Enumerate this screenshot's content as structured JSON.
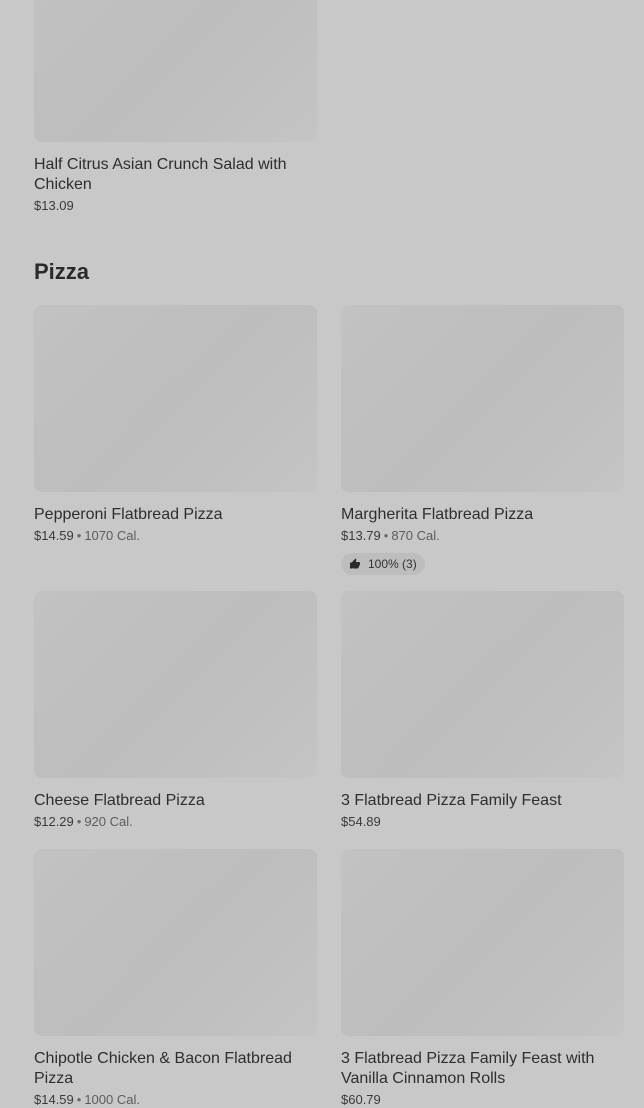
{
  "prev_item": {
    "name": "Half Citrus Asian Crunch Salad with Chicken",
    "price": "$13.09"
  },
  "section": {
    "title": "Pizza"
  },
  "items": [
    {
      "name": "Pepperoni Flatbread Pizza",
      "price": "$14.59",
      "separator": "•",
      "calories": "1070 Cal."
    },
    {
      "name": "Margherita Flatbread Pizza",
      "price": "$13.79",
      "separator": "•",
      "calories": "870 Cal.",
      "rating": "100% (3)",
      "rating_icon": "thumbs-up-icon"
    },
    {
      "name": "Cheese Flatbread Pizza",
      "price": "$12.29",
      "separator": "•",
      "calories": "920 Cal."
    },
    {
      "name": "3 Flatbread Pizza Family Feast",
      "price": "$54.89"
    },
    {
      "name": "Chipotle Chicken & Bacon Flatbread Pizza",
      "price": "$14.59",
      "separator": "•",
      "calories": "1000 Cal."
    },
    {
      "name": "3 Flatbread Pizza Family Feast with Vanilla Cinnamon Rolls",
      "price": "$60.79"
    }
  ]
}
